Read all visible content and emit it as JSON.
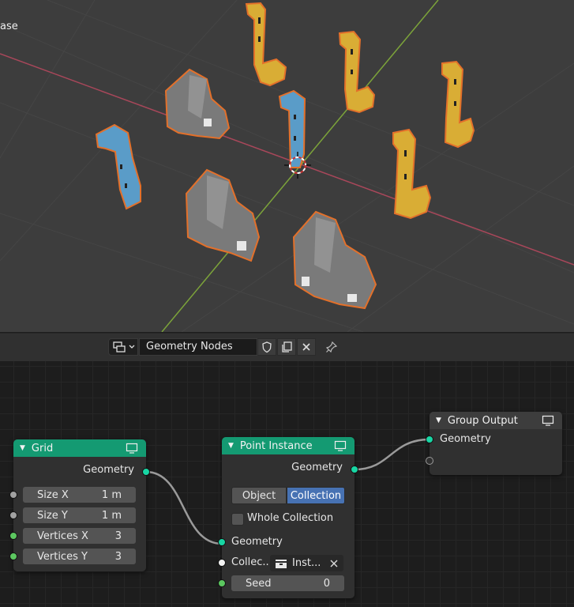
{
  "viewport": {
    "corner_text": "ase"
  },
  "header": {
    "editor_type_icon": "node-tree-icon",
    "node_group_name": "Geometry Nodes",
    "buttons": [
      "fake-user-shield-icon",
      "duplicate-icon",
      "close-icon",
      "pin-icon"
    ]
  },
  "nodes": {
    "grid": {
      "title": "Grid",
      "output_label": "Geometry",
      "inputs": [
        {
          "label": "Size X",
          "value": "1 m"
        },
        {
          "label": "Size Y",
          "value": "1 m"
        },
        {
          "label": "Vertices X",
          "value": "3"
        },
        {
          "label": "Vertices Y",
          "value": "3"
        }
      ]
    },
    "point_instance": {
      "title": "Point Instance",
      "output_label": "Geometry",
      "mode_options": [
        "Object",
        "Collection"
      ],
      "selected_mode": "Collection",
      "whole_collection_label": "Whole Collection",
      "geometry_input_label": "Geometry",
      "collection_label": "Collec...",
      "collection_value": "Inst...",
      "seed_label": "Seed",
      "seed_value": "0"
    },
    "group_output": {
      "title": "Group Output",
      "input_label": "Geometry"
    }
  },
  "colors": {
    "geometry_socket": "#18d6a4",
    "node_header_geometry": "#149a72",
    "selected_toggle": "#4772b3",
    "x_axis": "#a8475a",
    "y_axis": "#7ca33a",
    "yellow_object": "#e0b53a",
    "blue_object": "#5a9cc8",
    "selection_outline": "#e3702a"
  }
}
